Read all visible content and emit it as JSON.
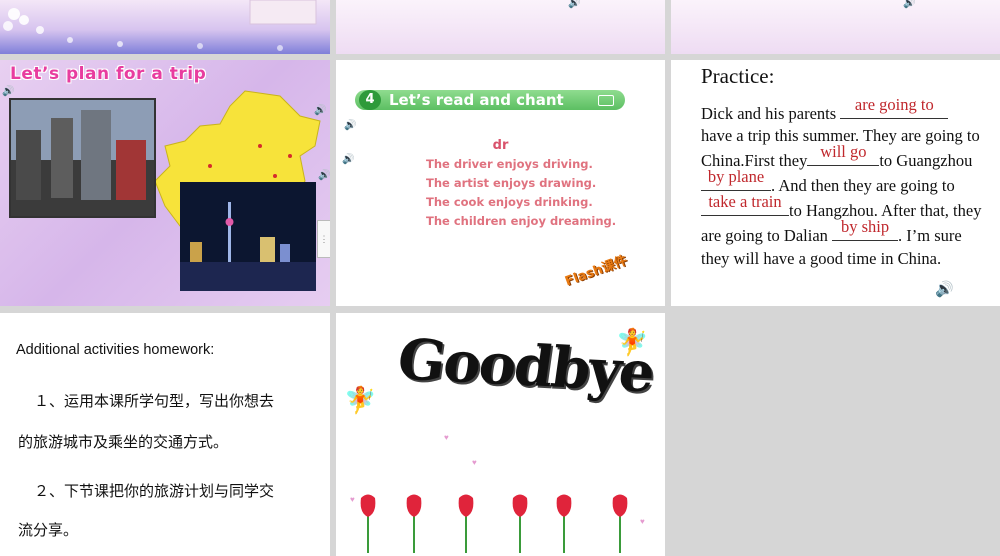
{
  "slides": {
    "plan_trip": {
      "title": "Let’s plan for a trip"
    },
    "chant": {
      "number": "4",
      "title": "Let’s read and chant",
      "sound": "dr",
      "lines": [
        "The driver enjoys driving.",
        "The artist enjoys drawing.",
        "The cook enjoys drinking.",
        "The children enjoy dreaming."
      ],
      "flash_label": "Flash课件"
    },
    "practice": {
      "title": "Practice:",
      "t1": "Dick and his parents ",
      "a1": "are  going to",
      "t2": " have a trip this summer. They are going to China.First they",
      "a2": "will go",
      "t3": "to Guangzhou",
      "a3": "by plane",
      "t4": ". And then they are going to",
      "a4": "take a train ",
      "t5": "to Hangzhou. After that, they are going to Dalian ",
      "a5": "by ship ",
      "t6": ". I’m sure they will have a good time in China."
    },
    "homework": {
      "title": "Additional activities homework:",
      "line1": "１、运用本课所学句型，写出你想去",
      "line2": "的旅游城市及乘坐的交通方式。",
      "line3": "２、下节课把你的旅游计划与同学交",
      "line4": "流分享。"
    },
    "goodbye": {
      "text": "Goodbye"
    }
  },
  "colors": {
    "accent_pink": "#e83d9f",
    "answer_red": "#c0282d",
    "chant_green": "#5cbf62"
  }
}
